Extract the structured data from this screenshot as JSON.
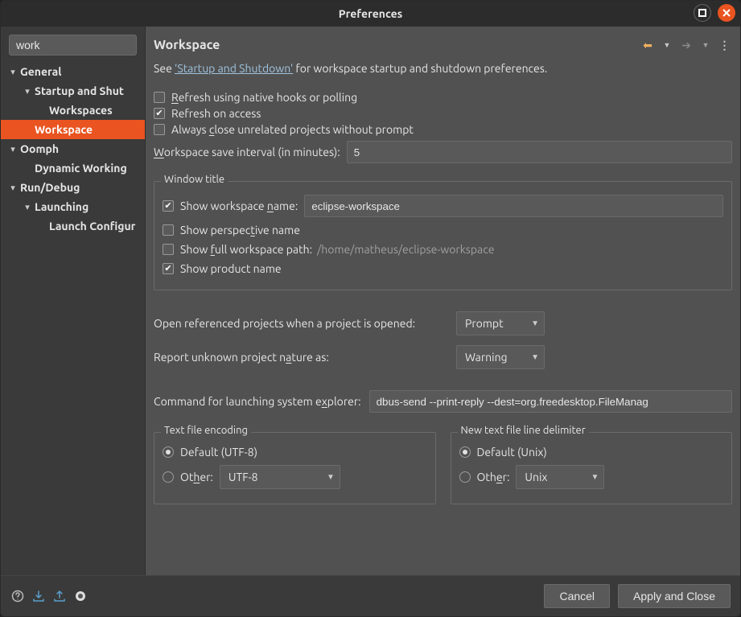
{
  "titlebar": {
    "title": "Preferences"
  },
  "search": {
    "value": "work"
  },
  "tree": {
    "items": [
      {
        "label": "General",
        "depth": 0,
        "caret": "▾",
        "bold": true
      },
      {
        "label": "Startup and Shut",
        "depth": 1,
        "caret": "▾",
        "bold": true
      },
      {
        "label": "Workspaces",
        "depth": 2,
        "caret": "",
        "bold": true
      },
      {
        "label": "Workspace",
        "depth": 1,
        "caret": "",
        "bold": true,
        "selected": true
      },
      {
        "label": "Oomph",
        "depth": 0,
        "caret": "▾",
        "bold": true
      },
      {
        "label": "Dynamic Working",
        "depth": 1,
        "caret": "",
        "bold": true
      },
      {
        "label": "Run/Debug",
        "depth": 0,
        "caret": "▾",
        "bold": true
      },
      {
        "label": "Launching",
        "depth": 1,
        "caret": "▾",
        "bold": true
      },
      {
        "label": "Launch Configur",
        "depth": 2,
        "caret": "",
        "bold": true
      }
    ]
  },
  "page": {
    "heading": "Workspace",
    "intro_pre": "See ",
    "intro_link": "'Startup and Shutdown'",
    "intro_post": " for workspace startup and shutdown preferences.",
    "refresh_native": {
      "checked": false,
      "label_pre": "",
      "label": "Refresh using native hooks or polling",
      "underline": "R"
    },
    "refresh_access": {
      "checked": true,
      "label": "Refresh on access"
    },
    "close_unrelated": {
      "checked": false,
      "label": "Always close unrelated projects without prompt",
      "underline": "c"
    },
    "save_interval": {
      "label": "Workspace save interval (in minutes):",
      "underline": "W",
      "value": "5"
    },
    "window_title": "Window title",
    "show_ws_name": {
      "checked": true,
      "label": "Show workspace name:",
      "underline": "n",
      "value": "eclipse-workspace"
    },
    "show_perspective": {
      "checked": false,
      "label": "Show perspective name",
      "underline": "t"
    },
    "show_full_path": {
      "checked": false,
      "label": "Show full workspace path:",
      "underline": "f",
      "path": "/home/matheus/eclipse-workspace"
    },
    "show_product": {
      "checked": true,
      "label": "Show product name"
    },
    "open_ref": {
      "label": "Open referenced projects when a project is opened:",
      "value": "Prompt"
    },
    "report_nature": {
      "label": "Report unknown project nature as:",
      "underline": "a",
      "value": "Warning"
    },
    "sys_explorer": {
      "label": "Command for launching system explorer:",
      "underline": "x",
      "value": "dbus-send --print-reply --dest=org.freedesktop.FileManag"
    },
    "encoding": {
      "legend": "Text file encoding",
      "default_label": "Default (UTF-8)",
      "other_label": "Other:",
      "underline": "h",
      "value": "UTF-8"
    },
    "delimiter": {
      "legend": "New text file line delimiter",
      "default_label": "Default (Unix)",
      "other_label": "Other:",
      "underline": "e",
      "value": "Unix"
    }
  },
  "footer": {
    "cancel": "Cancel",
    "apply": "Apply and Close"
  }
}
